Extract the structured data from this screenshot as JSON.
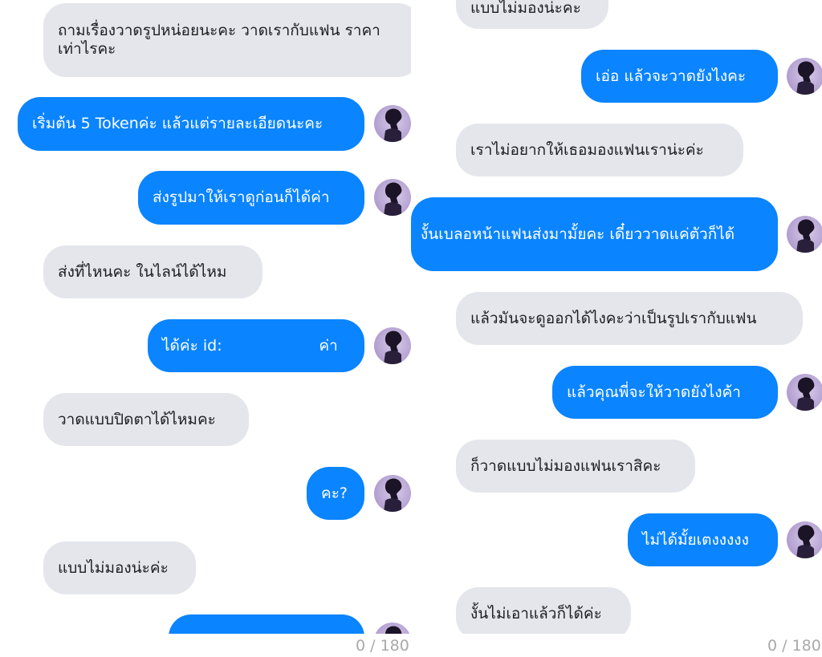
{
  "left_panel": {
    "messages": [
      {
        "text": "ถามเรื่องวาดรูปหน่อยนะคะ วาดเรากับแฟน ราคาเท่าไรคะ"
      },
      {
        "text": "เริ่มต้น 5 Tokenค่ะ แล้วแต่รายละเอียดนะคะ"
      },
      {
        "text": "ส่งรูปมาให้เราดูก่อนก็ได้ค่า"
      },
      {
        "text": "ส่งที่ไหนคะ ในไลน์ได้ไหม"
      },
      {
        "text": "ได้ค่ะ id:                    ค่า"
      },
      {
        "text": "วาดแบบปิดตาได้ไหมคะ"
      },
      {
        "text": "คะ?"
      },
      {
        "text": "แบบไม่มองน่ะค่ะ"
      },
      {
        "text": ""
      }
    ],
    "char_counter": "0 / 180"
  },
  "right_panel": {
    "messages": [
      {
        "text": "แบบไม่มองน่ะคะ"
      },
      {
        "text": "เอ่อ แล้วจะวาดยังไงคะ"
      },
      {
        "text": "เราไม่อยากให้เธอมองแฟนเราน่ะค่ะ"
      },
      {
        "text": "งั้นเบลอหน้าแฟนส่งมามั้ยคะ เดี๋ยววาดแค่ตัวก็ได้"
      },
      {
        "text": "แล้วมันจะดูออกได้ไงคะว่าเป็นรูปเรากับแฟน"
      },
      {
        "text": "แล้วคุณพี่จะให้วาดยังไงค้า"
      },
      {
        "text": "ก็วาดแบบไม่มองแฟนเราสิคะ"
      },
      {
        "text": "ไม่ได้มั้ยเตงงงงง"
      },
      {
        "text": "งั้นไม่เอาแล้วก็ได้ค่ะ"
      }
    ],
    "char_counter": "0 / 180"
  },
  "colors": {
    "outgoing_bubble": "#0a84ff",
    "incoming_bubble": "#e4e6eb",
    "avatar": "#b7a4d4"
  },
  "icons": [
    "avatar-icon"
  ]
}
